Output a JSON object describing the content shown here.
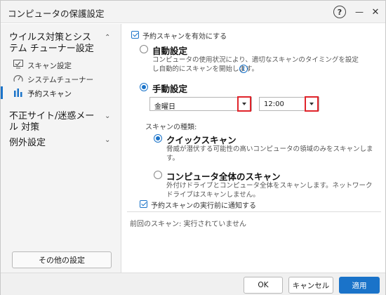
{
  "window": {
    "title": "コンピュータの保護設定"
  },
  "titlebar": {
    "help_label": "?",
    "minimize_label": "—",
    "close_label": "✕"
  },
  "sidebar": {
    "group_virus": "ウイルス対策とシステム チューナー設定",
    "items": [
      {
        "label": "スキャン設定",
        "icon": "scan-settings-icon"
      },
      {
        "label": "システムチューナー",
        "icon": "system-tuner-icon"
      },
      {
        "label": "予約スキャン",
        "icon": "scheduled-scan-icon"
      }
    ],
    "group_web": "不正サイト/迷惑メール 対策",
    "group_exceptions": "例外設定",
    "other_settings": "その他の設定"
  },
  "main": {
    "enable_scheduled": "予約スキャンを有効にする",
    "auto": {
      "title": "自動設定",
      "description": "コンピュータの使用状況により、適切なスキャンのタイミングを設定し自動的にスキャンを開始します。"
    },
    "manual": {
      "title": "手動設定",
      "day_value": "金曜日",
      "time_value": "12:00"
    },
    "scan_type_label": "スキャンの種類:",
    "quick": {
      "title": "クイックスキャン",
      "description": "脅威が潜伏する可能性の高いコンピュータの領域のみをスキャンします。"
    },
    "full": {
      "title": "コンピュータ全体のスキャン",
      "description": "外付けドライブとコンピュータ全体をスキャンします。ネットワークドライブはスキャンしません。"
    },
    "notify": "予約スキャンの実行前に通知する",
    "last_scan": "前回のスキャン: 実行されていません"
  },
  "footer": {
    "ok": "OK",
    "cancel": "キャンセル",
    "apply": "適用"
  },
  "colors": {
    "accent": "#1a73c9",
    "highlight": "#e0242b"
  }
}
